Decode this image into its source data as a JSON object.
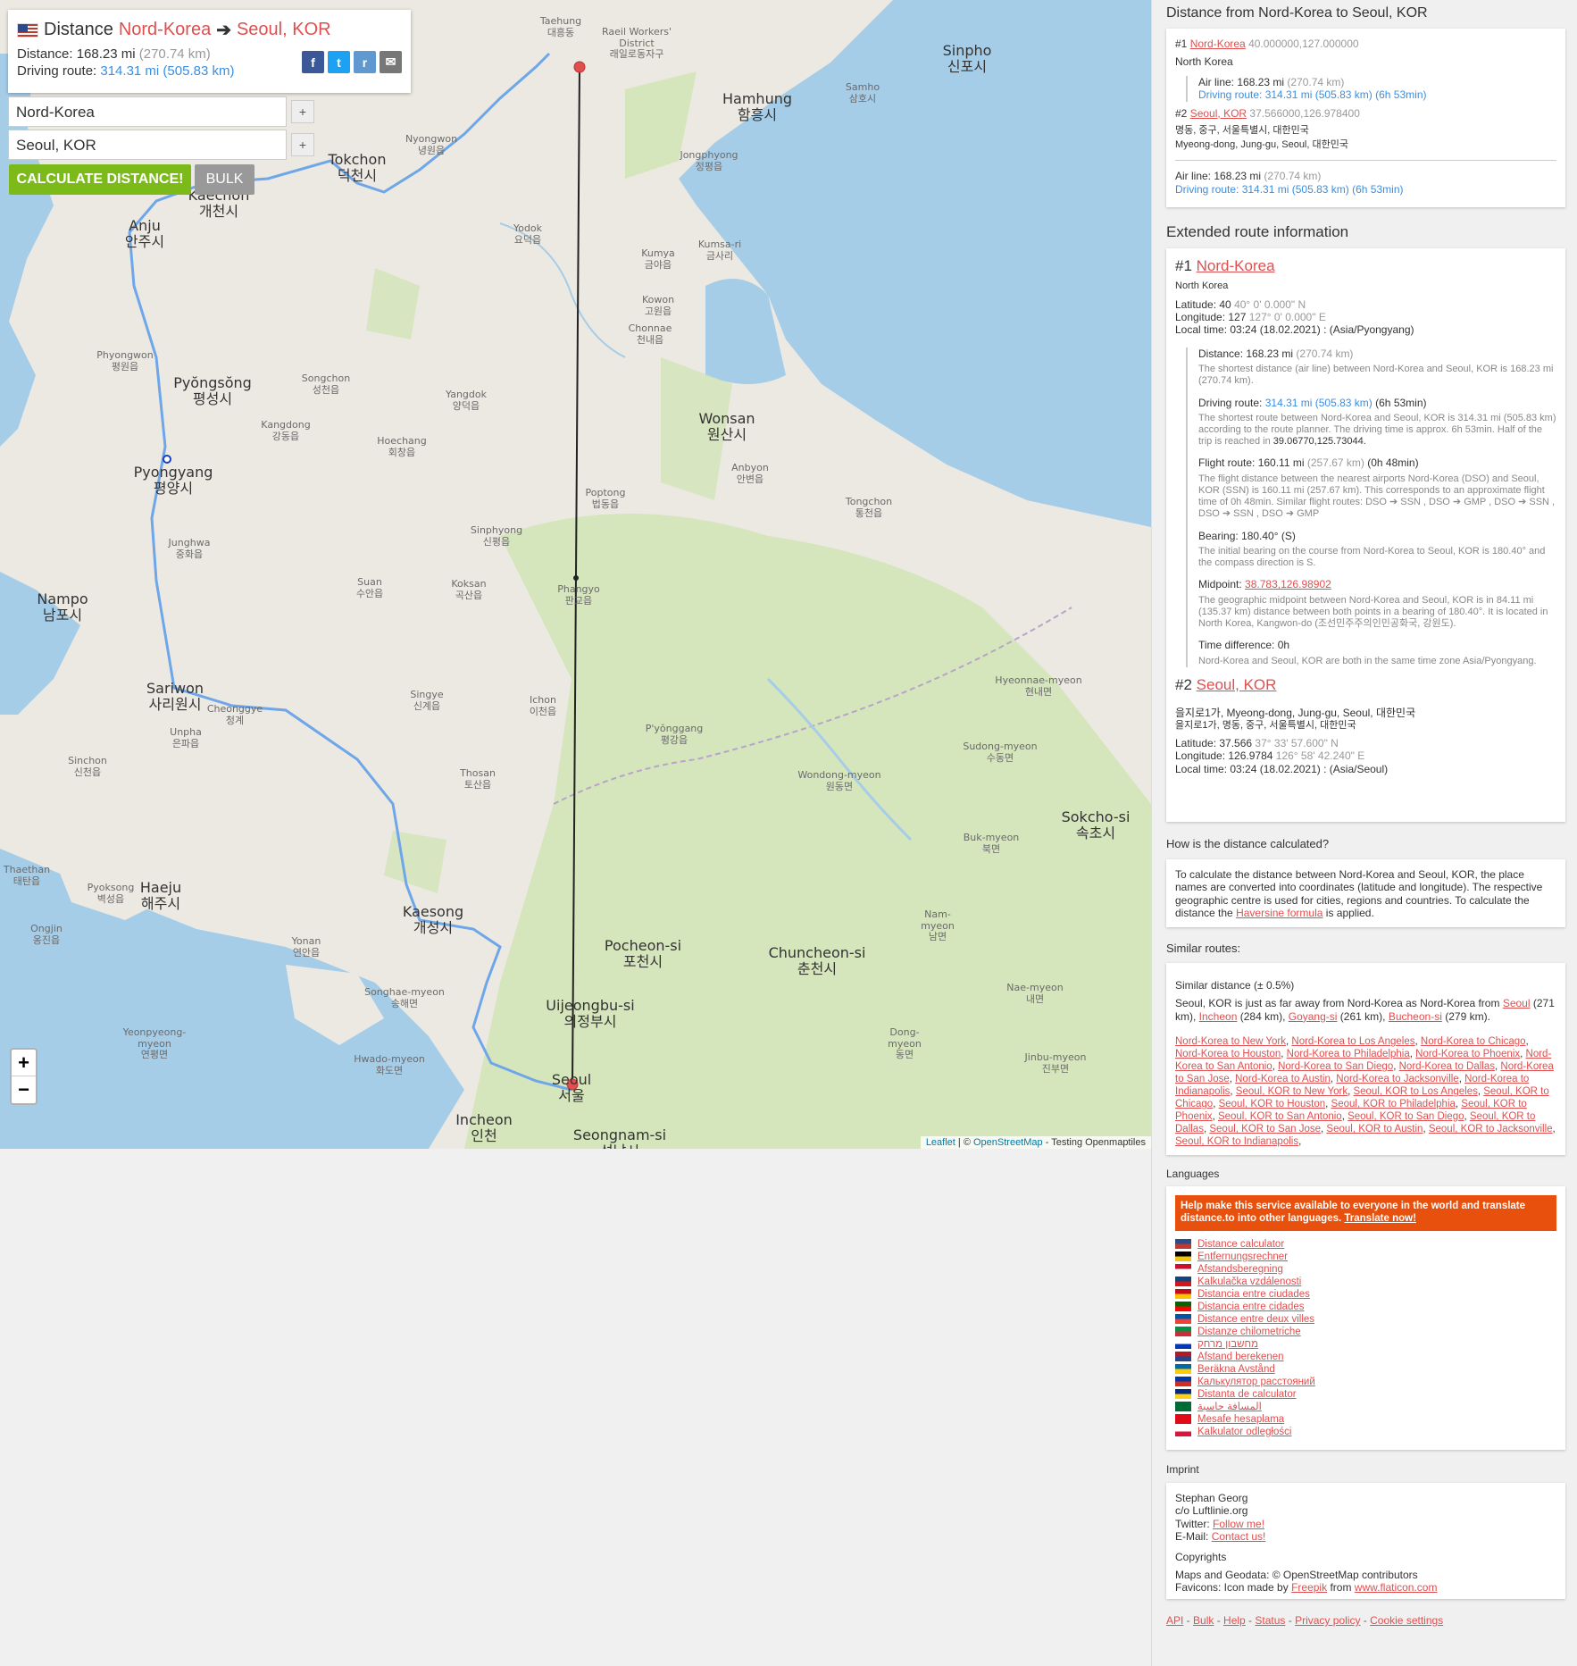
{
  "header": {
    "title_prefix": "Distance",
    "from": "Nord-Korea",
    "to": "Seoul, KOR",
    "distance_label": "Distance:",
    "distance_mi": "168.23 mi",
    "distance_km": "(270.74 km)",
    "driving_label": "Driving route:",
    "driving_mi": "314.31 mi",
    "driving_km": "(505.83 km)"
  },
  "share": {
    "facebook": "f",
    "twitter": "t",
    "reddit": "r",
    "email": "✉"
  },
  "inputs": {
    "from": "Nord-Korea",
    "to": "Seoul, KOR",
    "plus": "+"
  },
  "buttons": {
    "calculate": "CALCULATE DISTANCE!",
    "bulk": "BULK"
  },
  "zoom": {
    "in": "+",
    "out": "−"
  },
  "attribution": {
    "leaflet": "Leaflet",
    "sep": " | © ",
    "osm": "OpenStreetMap",
    "rest": " - Testing Openmaptiles"
  },
  "map_places": [
    {
      "name": "Taehung\n대흥동",
      "cls": "sm"
    },
    {
      "name": "Raeil Workers'\nDistrict\n래일로동자구",
      "cls": "sm"
    },
    {
      "name": "Sinpho\n신포시",
      "cls": "big"
    },
    {
      "name": "Hamhung\n함흥시",
      "cls": "big"
    },
    {
      "name": "Samho\n삼호시",
      "cls": "sm"
    },
    {
      "name": "Nyongwon\n녕원읍",
      "cls": "sm"
    },
    {
      "name": "Tokchon\n덕천시",
      "cls": "big"
    },
    {
      "name": "Jongphyong\n정평읍",
      "cls": "sm"
    },
    {
      "name": "Anju\n안주시",
      "cls": "big"
    },
    {
      "name": "Kaechon\n개천시",
      "cls": "big"
    },
    {
      "name": "Yodok\n요덕읍",
      "cls": "sm"
    },
    {
      "name": "Kumya\n금야읍",
      "cls": "sm"
    },
    {
      "name": "Kumsa-ri\n금사리",
      "cls": "sm"
    },
    {
      "name": "Kowon\n고원읍",
      "cls": "sm"
    },
    {
      "name": "Chonnae\n천내읍",
      "cls": "sm"
    },
    {
      "name": "Phyongwon\n평원읍",
      "cls": "sm"
    },
    {
      "name": "Pyŏngsŏng\n평성시",
      "cls": "big"
    },
    {
      "name": "Songchon\n성천읍",
      "cls": "sm"
    },
    {
      "name": "Yangdok\n양덕읍",
      "cls": "sm"
    },
    {
      "name": "Kangdong\n강동읍",
      "cls": "sm"
    },
    {
      "name": "Wonsan\n원산시",
      "cls": "big"
    },
    {
      "name": "Hoechang\n회창읍",
      "cls": "sm"
    },
    {
      "name": "Pyongyang\n평양시",
      "cls": "big"
    },
    {
      "name": "Anbyon\n안변읍",
      "cls": "sm"
    },
    {
      "name": "Poptong\n법동읍",
      "cls": "sm"
    },
    {
      "name": "Tongchon\n통천읍",
      "cls": "sm"
    },
    {
      "name": "Junghwa\n중화읍",
      "cls": "sm"
    },
    {
      "name": "Sinphyong\n신평읍",
      "cls": "sm"
    },
    {
      "name": "Nampo\n남포시",
      "cls": "big"
    },
    {
      "name": "Suan\n수안읍",
      "cls": "sm"
    },
    {
      "name": "Koksan\n곡산읍",
      "cls": "sm"
    },
    {
      "name": "Phangyo\n판교읍",
      "cls": "sm"
    },
    {
      "name": "Sariwon\n사리원시",
      "cls": "big"
    },
    {
      "name": "Cheonggye\n청계",
      "cls": "sm"
    },
    {
      "name": "Singye\n신계읍",
      "cls": "sm"
    },
    {
      "name": "Ichon\n이천읍",
      "cls": "sm"
    },
    {
      "name": "Hyeonnae-myeon\n현내면",
      "cls": "sm"
    },
    {
      "name": "Unpha\n은파읍",
      "cls": "sm"
    },
    {
      "name": "P'yŏnggang\n평강읍",
      "cls": "sm"
    },
    {
      "name": "Sudong-myeon\n수동면",
      "cls": "sm"
    },
    {
      "name": "Sinchon\n신천읍",
      "cls": "sm"
    },
    {
      "name": "Thosan\n토산읍",
      "cls": "sm"
    },
    {
      "name": "Wondong-myeon\n원동면",
      "cls": "sm"
    },
    {
      "name": "Sokcho-si\n속초시",
      "cls": "big"
    },
    {
      "name": "Buk-myeon\n북면",
      "cls": "sm"
    },
    {
      "name": "Thaethan\n태탄읍",
      "cls": "sm"
    },
    {
      "name": "Haeju\n해주시",
      "cls": "big"
    },
    {
      "name": "Pyoksong\n벽성읍",
      "cls": "sm"
    },
    {
      "name": "Kaesong\n개성시",
      "cls": "big"
    },
    {
      "name": "Nam-\nmyeon\n남면",
      "cls": "sm"
    },
    {
      "name": "Ongjin\n옹진읍",
      "cls": "sm"
    },
    {
      "name": "Yonan\n연안읍",
      "cls": "sm"
    },
    {
      "name": "Pocheon-si\n포천시",
      "cls": "big"
    },
    {
      "name": "Chuncheon-si\n춘천시",
      "cls": "big"
    },
    {
      "name": "Songhae-myeon\n송해면",
      "cls": "sm"
    },
    {
      "name": "Uijeongbu-si\n의정부시",
      "cls": "big"
    },
    {
      "name": "Nae-myeon\n내면",
      "cls": "sm"
    },
    {
      "name": "Yeonpyeong-\nmyeon\n연평면",
      "cls": "sm"
    },
    {
      "name": "Dong-\nmyeon\n동면",
      "cls": "sm"
    },
    {
      "name": "Hwado-myeon\n화도면",
      "cls": "sm"
    },
    {
      "name": "Seoul\n서울",
      "cls": "big"
    },
    {
      "name": "Jinbu-myeon\n진부면",
      "cls": "sm"
    },
    {
      "name": "Incheon\n인천",
      "cls": "big"
    },
    {
      "name": "Seongnam-si\n성남시",
      "cls": "big"
    }
  ],
  "sidebar": {
    "title": "Distance from Nord-Korea to Seoul, KOR",
    "p1": {
      "num": "#1",
      "name": "Nord-Korea",
      "coords": "40.000000,127.000000",
      "addr": "North Korea",
      "air_label": "Air line: 168.23 mi",
      "air_km": "(270.74 km)",
      "drive_label": "Driving route: 314.31 mi",
      "drive_km": "(505.83 km)",
      "drive_time": "(6h 53min)"
    },
    "p2": {
      "num": "#2",
      "name": "Seoul, KOR",
      "coords": "37.566000,126.978400",
      "addr1": "명동, 중구, 서울특별시, 대한민국",
      "addr2": "Myeong-dong, Jung-gu, Seoul, 대한민국"
    },
    "total": {
      "air_label": "Air line: 168.23 mi",
      "air_km": "(270.74 km)",
      "drive_label": "Driving route: 314.31 mi",
      "drive_km": "(505.83 km)",
      "drive_time": "(6h 53min)"
    },
    "ext_title": "Extended route information",
    "ext1": {
      "num": "#1",
      "name": "Nord-Korea",
      "addr": "North Korea",
      "lat": "Latitude: 40",
      "lat_dms": "40° 0' 0.000\" N",
      "lon": "Longitude: 127",
      "lon_dms": "127° 0' 0.000\" E",
      "time": "Local time: 03:24 (18.02.2021) : (Asia/Pyongyang)"
    },
    "dist": {
      "label": "Distance: 168.23 mi",
      "km": "(270.74 km)",
      "desc": "The shortest distance (air line) between Nord-Korea and Seoul, KOR is 168.23 mi (270.74 km)."
    },
    "drive": {
      "label": "Driving route:",
      "mi": "314.31 mi",
      "km": "(505.83 km)",
      "time": "(6h 53min)",
      "desc": "The shortest route between Nord-Korea and Seoul, KOR is 314.31 mi (505.83 km) according to the route planner. The driving time is approx. 6h 53min. Half of the trip is reached in",
      "half": "39.06770,125.73044."
    },
    "flight": {
      "label": "Flight route: 160.11 mi",
      "km": "(257.67 km)",
      "time": "(0h 48min)",
      "desc": "The flight distance between the nearest airports Nord-Korea (DSO) and Seoul, KOR (SSN) is 160.11 mi (257.67 km). This corresponds to an approximate flight time of 0h 48min. Similar flight routes: DSO ➔ SSN , DSO ➔ GMP , DSO ➔ SSN , DSO ➔ SSN , DSO ➔ GMP"
    },
    "bearing": {
      "label": "Bearing: 180.40° (S)",
      "desc": "The initial bearing on the course from Nord-Korea to Seoul, KOR is 180.40° and the compass direction is S."
    },
    "midpoint": {
      "label": "Midpoint:",
      "value": "38.783,126.98902",
      "desc": "The geographic midpoint between Nord-Korea and Seoul, KOR is in 84.11 mi (135.37 km) distance between both points in a bearing of 180.40°. It is located in North Korea, Kangwon-do (조선민주주의인민공화국, 강원도)."
    },
    "timediff": {
      "label": "Time difference: 0h",
      "desc": "Nord-Korea and Seoul, KOR are both in the same time zone Asia/Pyongyang."
    },
    "ext2": {
      "num": "#2",
      "name": "Seoul, KOR",
      "addr1": "을지로1가, Myeong-dong, Jung-gu, Seoul, 대한민국",
      "addr2": "을지로1가, 명동, 중구, 서울특별시, 대한민국",
      "lat": "Latitude: 37.566",
      "lat_dms": "37° 33' 57.600\" N",
      "lon": "Longitude: 126.9784",
      "lon_dms": "126° 58' 42.240\" E",
      "time": "Local time: 03:24 (18.02.2021) : (Asia/Seoul)"
    },
    "how_title": "How is the distance calculated?",
    "how_text": "To calculate the distance between Nord-Korea and Seoul, KOR, the place names are converted into coordinates (latitude and longitude). The respective geographic centre is used for cities, regions and countries. To calculate the distance the",
    "how_link": "Haversine formula",
    "how_end": " is applied.",
    "similar_title": "Similar routes:",
    "similar_sub": "Similar distance (± 0.5%)",
    "similar_text": "Seoul, KOR is just as far away from Nord-Korea as Nord-Korea from",
    "similar_places": [
      "Seoul",
      "Incheon",
      "Goyang-si",
      "Bucheon-si"
    ],
    "similar_kms": [
      "(271 km),",
      "(284 km),",
      "(261 km),",
      "(279 km)."
    ],
    "routes": [
      "Nord-Korea to New York",
      "Nord-Korea to Los Angeles",
      "Nord-Korea to Chicago",
      "Nord-Korea to Houston",
      "Nord-Korea to Philadelphia",
      "Nord-Korea to Phoenix",
      "Nord-Korea to San Antonio",
      "Nord-Korea to San Diego",
      "Nord-Korea to Dallas",
      "Nord-Korea to San Jose",
      "Nord-Korea to Austin",
      "Nord-Korea to Jacksonville",
      "Nord-Korea to Indianapolis",
      "Seoul, KOR to New York",
      "Seoul, KOR to Los Angeles",
      "Seoul, KOR to Chicago",
      "Seoul, KOR to Houston",
      "Seoul, KOR to Philadelphia",
      "Seoul, KOR to Phoenix",
      "Seoul, KOR to San Antonio",
      "Seoul, KOR to San Diego",
      "Seoul, KOR to Dallas",
      "Seoul, KOR to San Jose",
      "Seoul, KOR to Austin",
      "Seoul, KOR to Jacksonville",
      "Seoul, KOR to Indianapolis"
    ],
    "lang_title": "Languages",
    "notice": "Help make this service available to everyone in the world and translate distance.to into other languages.",
    "notice_link": "Translate now!",
    "languages": [
      {
        "label": "Distance calculator",
        "c1": "#2d4a8a",
        "c2": "#c0392b"
      },
      {
        "label": "Entfernungsrechner",
        "c1": "#000",
        "c2": "#f1c40f"
      },
      {
        "label": "Afstandsberegning",
        "c1": "#c8102e",
        "c2": "#fff"
      },
      {
        "label": "Kalkulačka vzdálenosti",
        "c1": "#11457e",
        "c2": "#d7141a"
      },
      {
        "label": "Distancia entre ciudades",
        "c1": "#c60b1e",
        "c2": "#ffc400"
      },
      {
        "label": "Distancia entre cidades",
        "c1": "#006600",
        "c2": "#ff0000"
      },
      {
        "label": "Distance entre deux villes",
        "c1": "#0055a4",
        "c2": "#ef4135"
      },
      {
        "label": "Distanze chilometriche",
        "c1": "#009246",
        "c2": "#ce2b37"
      },
      {
        "label": "מחשבון מרחק",
        "c1": "#fff",
        "c2": "#0038b8"
      },
      {
        "label": "Afstand berekenen",
        "c1": "#ae1c28",
        "c2": "#21468b"
      },
      {
        "label": "Beräkna Avstånd",
        "c1": "#006aa7",
        "c2": "#fecc00"
      },
      {
        "label": "Калькулятор расстояний",
        "c1": "#0039a6",
        "c2": "#d52b1e"
      },
      {
        "label": "Distanta de calculator",
        "c1": "#002b7f",
        "c2": "#fcd116"
      },
      {
        "label": "المسافة حاسبة",
        "c1": "#006c35",
        "c2": "#006c35"
      },
      {
        "label": "Mesafe hesaplama",
        "c1": "#e30a17",
        "c2": "#e30a17"
      },
      {
        "label": "Kalkulator odległości",
        "c1": "#fff",
        "c2": "#dc143c"
      }
    ],
    "imprint_title": "Imprint",
    "imprint": {
      "name": "Stephan Georg",
      "co": "c/o Luftlinie.org",
      "twitter_label": "Twitter:",
      "twitter_link": "Follow me!",
      "email_label": "E-Mail:",
      "email_link": "Contact us!",
      "copy_title": "Copyrights",
      "maps": "Maps and Geodata: © OpenStreetMap contributors",
      "fav1": "Favicons: Icon made by",
      "fav_link": "Freepik",
      "fav2": "from",
      "fav_link2": "www.flaticon.com"
    },
    "footer": [
      "API",
      "Bulk",
      "Help",
      "Status",
      "Privacy policy",
      "Cookie settings"
    ]
  }
}
